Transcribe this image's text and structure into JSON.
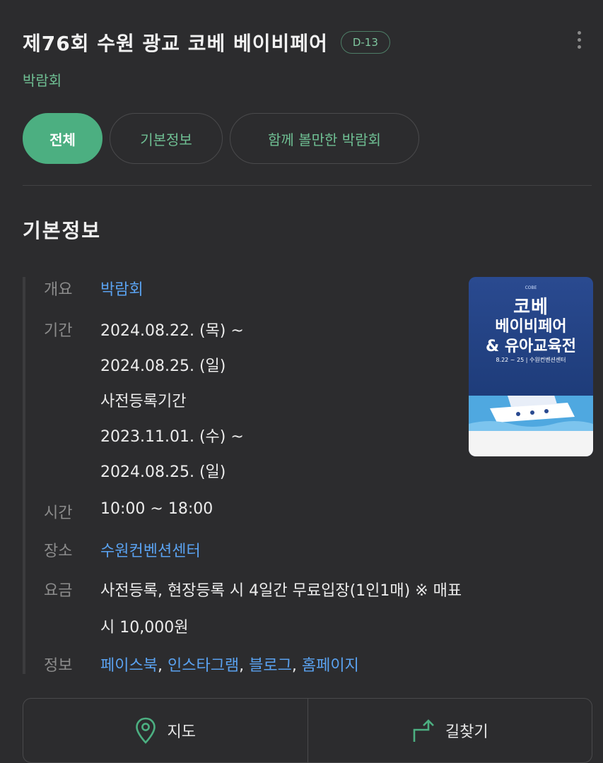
{
  "header": {
    "title": "제76회 수원 광교 코베 베이비페어",
    "dday": "D-13",
    "category": "박람회"
  },
  "tabs": [
    {
      "label": "전체",
      "active": true
    },
    {
      "label": "기본정보",
      "active": false
    },
    {
      "label": "함께 볼만한 박람회",
      "active": false
    }
  ],
  "section": {
    "title": "기본정보"
  },
  "info": {
    "overview": {
      "label": "개요",
      "value": "박람회"
    },
    "period": {
      "label": "기간",
      "lines": [
        "2024.08.22. (목) ~",
        "2024.08.25. (일)",
        "사전등록기간",
        "2023.11.01. (수) ~",
        "2024.08.25. (일)"
      ]
    },
    "time": {
      "label": "시간",
      "value": "10:00 ~ 18:00"
    },
    "place": {
      "label": "장소",
      "value": "수원컨벤션센터"
    },
    "fee": {
      "label": "요금",
      "lines": [
        "사전등록, 현장등록 시 4일간 무료입장(1인1매) ※ 매표",
        "시 10,000원"
      ]
    },
    "links": {
      "label": "정보",
      "items": [
        "페이스북",
        "인스타그램",
        "블로그",
        "홈페이지"
      ],
      "sep": ","
    }
  },
  "poster": {
    "small": "COBE",
    "line1": "코베",
    "line2": "베이비페어",
    "line3": "& 유아교육전",
    "date": "8.22 ~ 25 | 수원컨벤션센터",
    "colors": {
      "top": "#2a4a90",
      "sea": "#4fa8e0",
      "bottom": "#f4f4f4"
    }
  },
  "actions": {
    "map": {
      "label": "지도",
      "icon": "map-pin-icon"
    },
    "directions": {
      "label": "길찾기",
      "icon": "directions-arrow-icon"
    }
  },
  "colors": {
    "accent": "#4caf81",
    "link": "#5aa2f0",
    "background": "#2c2c2e"
  }
}
